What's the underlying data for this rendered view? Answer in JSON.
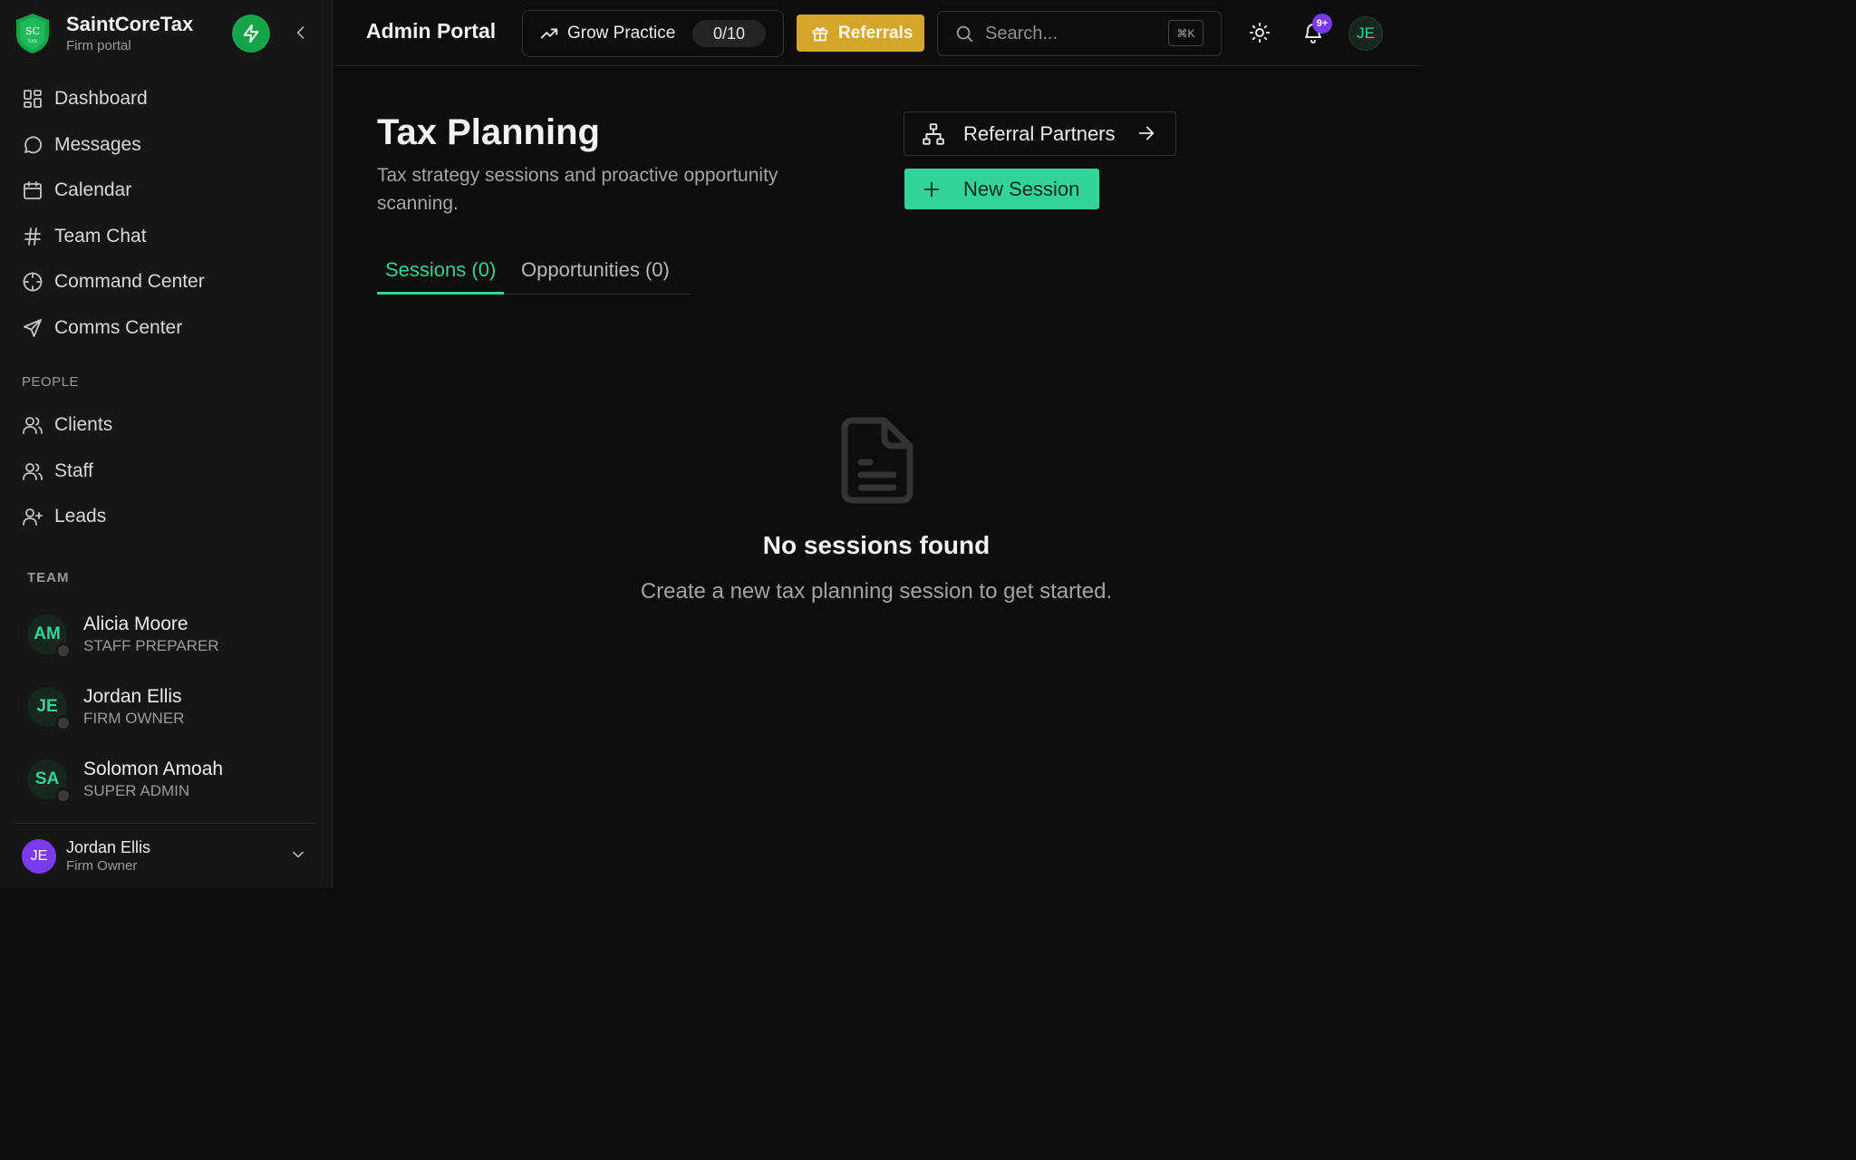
{
  "brand": {
    "name": "SaintCoreTax",
    "subtitle": "Firm portal",
    "logo_initials": "SC",
    "logo_tag": "TAX"
  },
  "sidebar": {
    "nav": [
      {
        "label": "Dashboard",
        "icon": "layout-grid-icon"
      },
      {
        "label": "Messages",
        "icon": "message-circle-icon"
      },
      {
        "label": "Calendar",
        "icon": "calendar-icon"
      },
      {
        "label": "Team Chat",
        "icon": "hash-icon"
      },
      {
        "label": "Command Center",
        "icon": "crosshair-icon"
      },
      {
        "label": "Comms Center",
        "icon": "send-icon"
      }
    ],
    "people_label": "PEOPLE",
    "people": [
      {
        "label": "Clients",
        "icon": "users-icon"
      },
      {
        "label": "Staff",
        "icon": "users-icon"
      },
      {
        "label": "Leads",
        "icon": "user-plus-icon"
      }
    ],
    "team_label": "TEAM",
    "team": [
      {
        "initials": "AM",
        "name": "Alicia Moore",
        "role": "STAFF PREPARER"
      },
      {
        "initials": "JE",
        "name": "Jordan Ellis",
        "role": "FIRM OWNER"
      },
      {
        "initials": "SA",
        "name": "Solomon Amoah",
        "role": "SUPER ADMIN"
      }
    ],
    "current_user": {
      "initials": "JE",
      "name": "Jordan Ellis",
      "role": "Firm Owner"
    }
  },
  "topbar": {
    "title": "Admin Portal",
    "grow_label": "Grow Practice",
    "grow_progress": "0/10",
    "referrals_label": "Referrals",
    "search_placeholder": "Search...",
    "search_shortcut": "⌘K",
    "notification_count": "9+",
    "avatar_initials": "JE"
  },
  "main": {
    "title": "Tax Planning",
    "description": "Tax strategy sessions and proactive opportunity scanning.",
    "partners_button": "Referral Partners",
    "new_session_button": "New Session",
    "tabs": [
      {
        "label": "Sessions (0)",
        "active": true
      },
      {
        "label": "Opportunities (0)",
        "active": false
      }
    ],
    "empty_title": "No sessions found",
    "empty_subtitle": "Create a new tax planning session to get started."
  },
  "colors": {
    "background": "#0d0d0d",
    "sidebar": "#161616",
    "accent": "#34d399",
    "brand_green": "#16a34a",
    "referrals_gold": "#d4a72c",
    "badge_purple": "#7c3aed"
  }
}
